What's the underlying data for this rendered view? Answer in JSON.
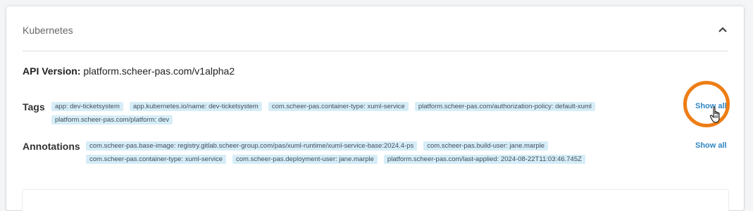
{
  "section": {
    "title": "Kubernetes",
    "collapse_icon": "chevron-up-icon"
  },
  "api_version": {
    "label": "API Version:",
    "value": " platform.scheer-pas.com/v1alpha2"
  },
  "tags": {
    "label": "Tags",
    "show_all": "Show all",
    "items": [
      "app: dev-ticketsystem",
      "app.kubernetes.io/name: dev-ticketsystem",
      "com.scheer-pas.container-type: xuml-service",
      "platform.scheer-pas.com/authorization-policy: default-xuml",
      "platform.scheer-pas.com/platform: dev"
    ]
  },
  "annotations": {
    "label": "Annotations",
    "show_all": "Show all",
    "items": [
      "com.scheer-pas.base-image: registry.gitlab.scheer-group.com/pas/xuml-runtime/xuml-service-base:2024.4-ps",
      "com.scheer-pas.build-user: jane.marple",
      "com.scheer-pas.container-type: xuml-service",
      "com.scheer-pas.deployment-user: jane.marple",
      "platform.scheer-pas.com/last-applied: 2024-08-22T11:03:46.745Z"
    ]
  },
  "colors": {
    "chip_bg": "#d6edf8",
    "link": "#2f86c4",
    "highlight_ring": "#ee7d14"
  }
}
